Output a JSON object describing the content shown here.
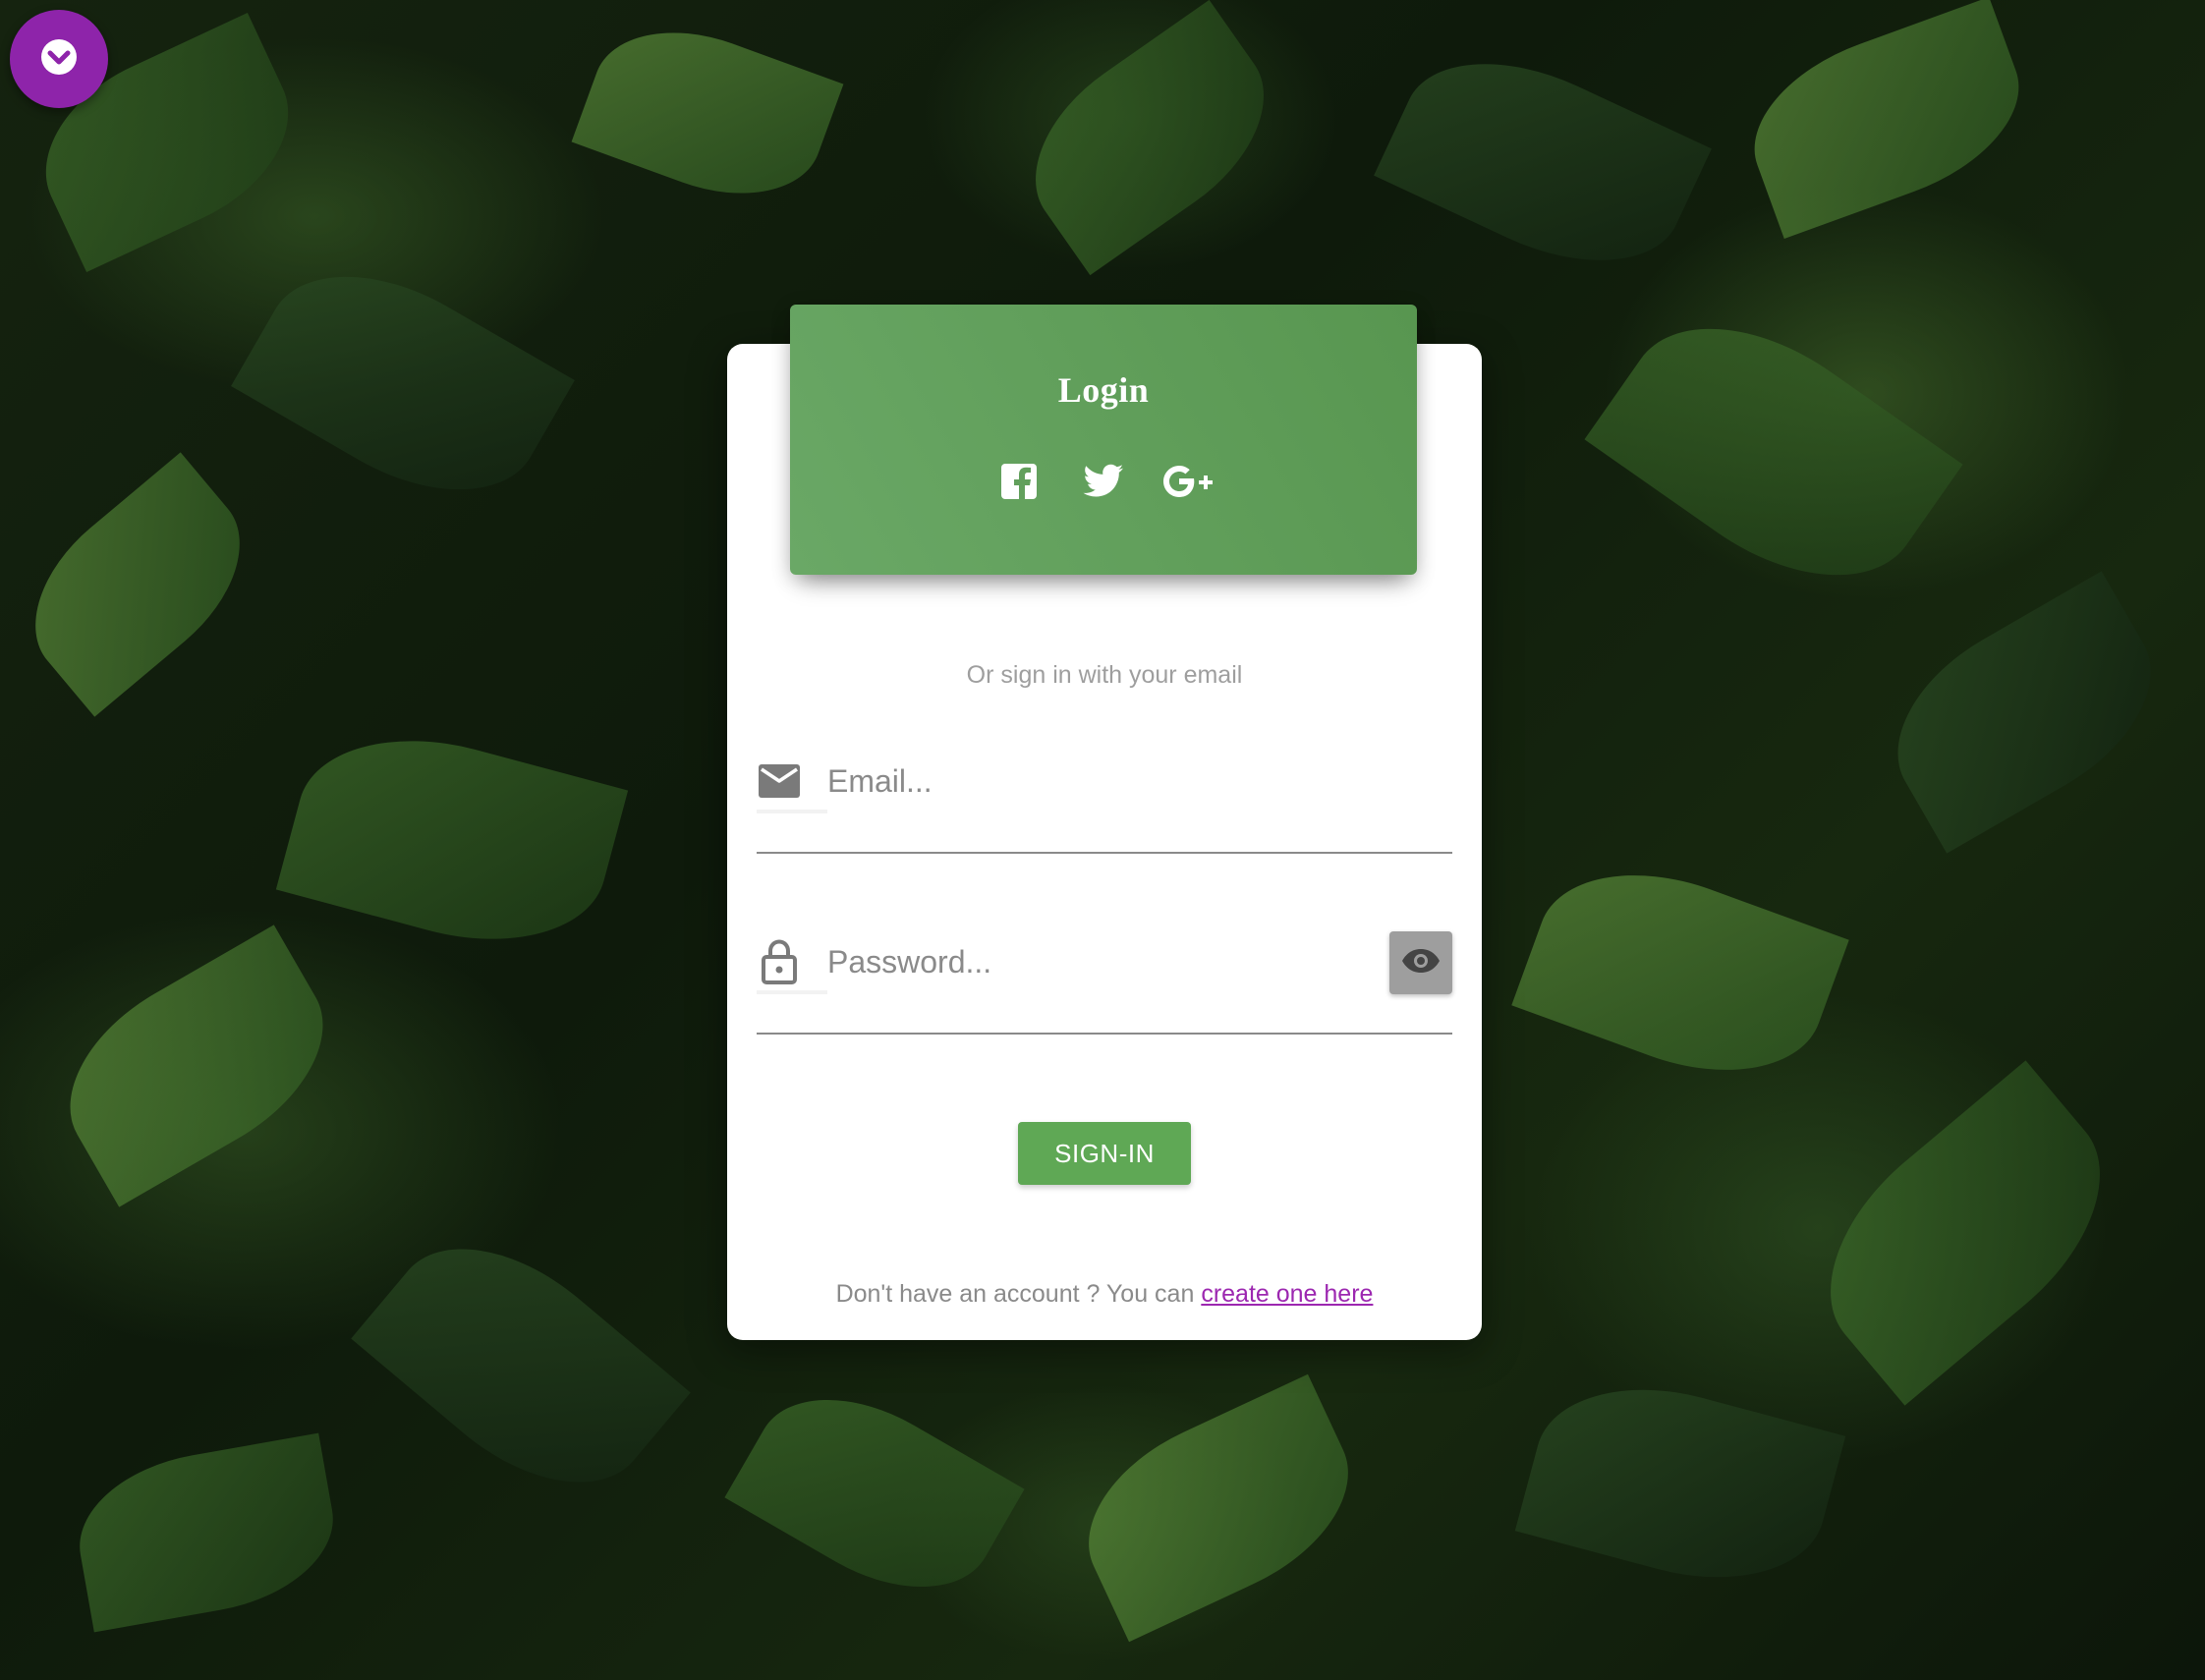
{
  "colors": {
    "accent_green": "#5fa855",
    "header_green": "#6aa866",
    "fab_purple": "#8e24aa",
    "link_purple": "#9c27b0",
    "muted_text": "#8a8a8a"
  },
  "fab": {
    "icon": "chevron-down-circle-icon"
  },
  "card": {
    "title": "Login",
    "social": [
      {
        "name": "facebook",
        "icon": "facebook-icon"
      },
      {
        "name": "twitter",
        "icon": "twitter-icon"
      },
      {
        "name": "google-plus",
        "icon": "google-plus-icon"
      }
    ],
    "hint": "Or sign in with your email"
  },
  "form": {
    "email": {
      "placeholder": "Email...",
      "value": "",
      "icon": "mail-icon"
    },
    "password": {
      "placeholder": "Password...",
      "value": "",
      "icon": "lock-icon",
      "toggle_icon": "eye-icon"
    },
    "submit_label": "SIGN-IN"
  },
  "footer": {
    "text": "Don't have an account ? You can",
    "link_text": "create one here"
  }
}
